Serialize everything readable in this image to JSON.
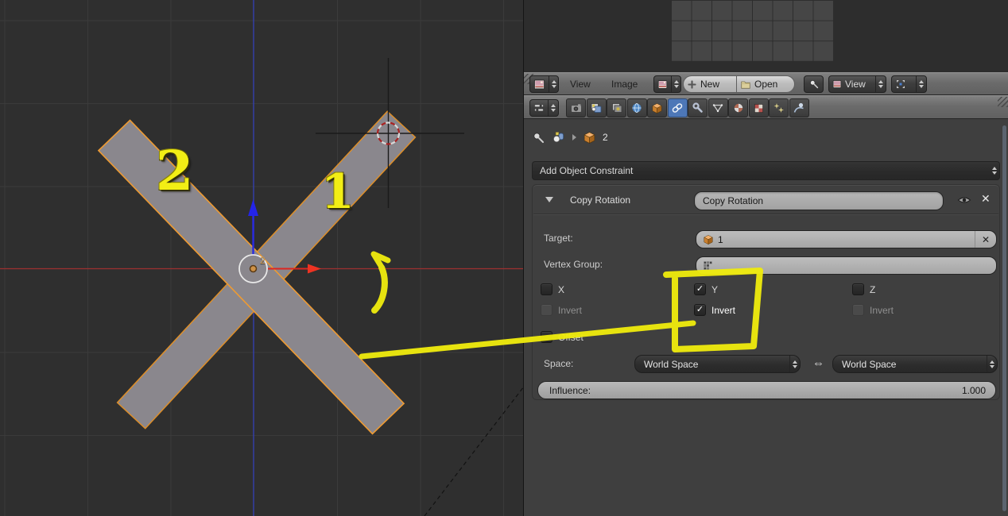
{
  "viewport": {
    "annotation_label_1": "1",
    "annotation_label_2": "2",
    "origin_object_label": "2"
  },
  "image_editor_header": {
    "menu_view": "View",
    "menu_image": "Image",
    "new_label": "New",
    "open_label": "Open",
    "view_mode_label": "View"
  },
  "properties_header": {
    "tabs": [
      "render",
      "scene",
      "render-layers",
      "world",
      "object",
      "constraints",
      "modifiers",
      "object-data",
      "material",
      "texture",
      "particles",
      "physics"
    ],
    "active_tab": "constraints"
  },
  "breadcrumb": {
    "object_name": "2"
  },
  "panel": {
    "add_constraint_label": "Add Object Constraint"
  },
  "constraint": {
    "type": "Copy Rotation",
    "name": "Copy Rotation",
    "target_label": "Target:",
    "target_object": "1",
    "vertex_group_label": "Vertex Group:",
    "axis_x_label": "X",
    "axis_y_label": "Y",
    "axis_z_label": "Z",
    "invert_label": "Invert",
    "offset_label": "Offset",
    "space_label": "Space:",
    "owner_space": "World Space",
    "space_arrow": "⇔",
    "target_space": "World Space",
    "influence_label": "Influence:",
    "influence_value": "1.000",
    "check_glyph": "✓",
    "close_glyph": "✕",
    "checkbox_states": {
      "x": false,
      "invert_x": false,
      "y": true,
      "invert_y": true,
      "z": false,
      "invert_z": false,
      "offset": false
    }
  },
  "colors": {
    "active_tab_blue": "#4d77b7",
    "selected_outline_orange": "#ef9b32",
    "annotation_yellow": "#eeea0e",
    "axis_red": "#9e3030",
    "axis_blue": "#333fae",
    "viewport_bg": "#2f2f2f",
    "panel_bg": "#3f3f3f"
  }
}
